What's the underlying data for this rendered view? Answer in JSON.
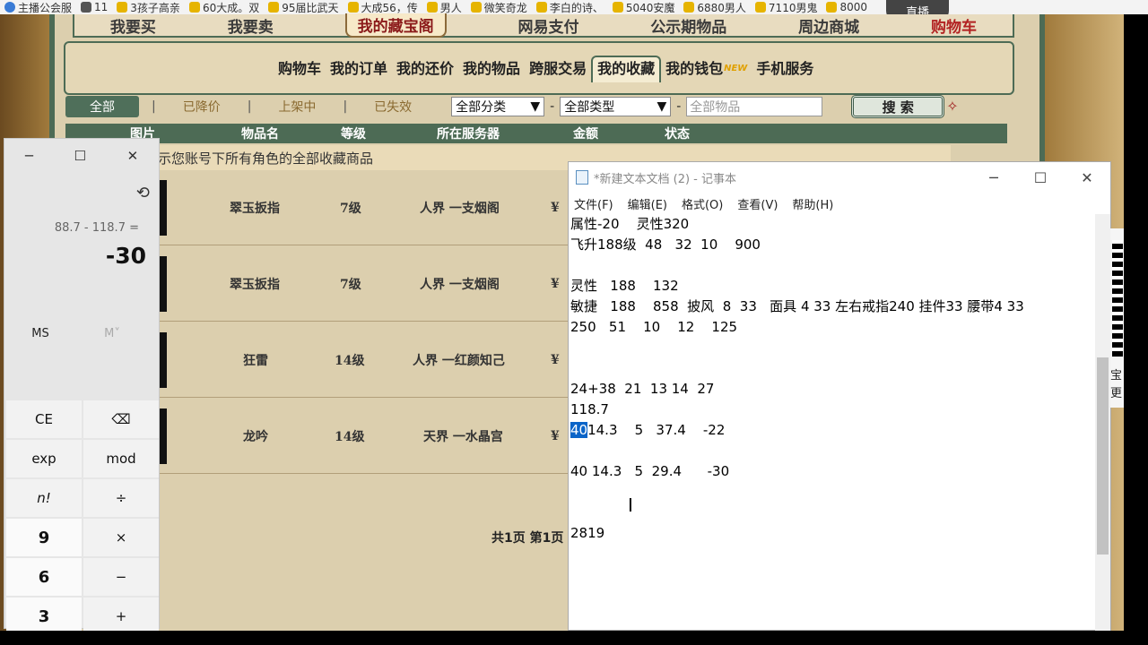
{
  "bookmarks": [
    {
      "label": "主播公会服",
      "icon": "blue-circle-icon"
    },
    {
      "label": "11",
      "icon": "folder-icon"
    },
    {
      "label": "3孩子高亲",
      "icon": "folder-icon"
    },
    {
      "label": "60大成。双",
      "icon": "folder-icon"
    },
    {
      "label": "95届比武天",
      "icon": "folder-icon"
    },
    {
      "label": "大成56，传",
      "icon": "folder-icon"
    },
    {
      "label": "男人",
      "icon": "folder-icon"
    },
    {
      "label": "微笑奇龙",
      "icon": "folder-icon"
    },
    {
      "label": "李白的诗、",
      "icon": "folder-icon"
    },
    {
      "label": "5040安魔",
      "icon": "folder-icon"
    },
    {
      "label": "6880男人",
      "icon": "folder-icon"
    },
    {
      "label": "7110男鬼",
      "icon": "folder-icon"
    },
    {
      "label": "8000",
      "icon": "folder-icon"
    }
  ],
  "live_badge": "直播",
  "game": {
    "top_categories": [
      "我要买",
      "我要卖",
      "我的藏宝阁",
      "网易支付",
      "公示期物品",
      "周边商城",
      "购物车"
    ],
    "subnav": [
      "购物车",
      "我的订单",
      "我的还价",
      "我的物品",
      "跨服交易",
      "我的收藏",
      "我的钱包",
      "手机服务"
    ],
    "subnav_active": "我的收藏",
    "new_badge": "NEW",
    "filters": {
      "all": "全部",
      "price_drop": "已降价",
      "on_shelf": "上架中",
      "expired": "已失效",
      "category_select": "全部分类",
      "type_select": "全部类型",
      "search_placeholder": "全部物品",
      "search_button": "搜 索"
    },
    "columns": [
      "图片",
      "物品名",
      "等级",
      "所在服务器",
      "金额",
      "状态"
    ],
    "notice": "示：已展示您账号下所有角色的全部收藏商品",
    "rows": [
      {
        "name": "翠玉扳指",
        "level": "7级",
        "server": "人界 一支烟阁",
        "price": "¥"
      },
      {
        "name": "翠玉扳指",
        "level": "7级",
        "server": "人界 一支烟阁",
        "price": "¥"
      },
      {
        "name": "狂雷",
        "level": "14级",
        "server": "人界 一红颜知己",
        "price": "¥"
      },
      {
        "name": "龙吟",
        "level": "14级",
        "server": "天界 一水晶宫",
        "price": "¥"
      }
    ],
    "pager": "共1页 第1页"
  },
  "calculator": {
    "expression": "88.7 - 118.7 =",
    "result": "-30",
    "memory": [
      "MS",
      "M˅"
    ],
    "keys": [
      "CE",
      "⌫",
      "exp",
      "mod",
      "n!",
      "÷",
      "9",
      "×",
      "6",
      "−",
      "3",
      "+"
    ]
  },
  "notepad": {
    "title": "*新建文本文档 (2) - 记事本",
    "menu": [
      "文件(F)",
      "编辑(E)",
      "格式(O)",
      "查看(V)",
      "帮助(H)"
    ],
    "lines": [
      "属性-20    灵性320",
      "飞升188级  48   32  10    900",
      "",
      "灵性   188    132",
      "敏捷   188    858  披风  8  33   面具 4 33 左右戒指240 挂件33 腰带4 33",
      "250   51    10    12    125",
      "",
      "",
      "24+38  21  13 14  27",
      "118.7",
      "",
      "",
      "40 14.3   5  29.4      -30",
      "",
      "",
      "2819"
    ],
    "selected_line": {
      "selected": "40",
      "rest": "14.3    5   37.4    -22"
    }
  },
  "side_chars": [
    "宝",
    "更"
  ]
}
